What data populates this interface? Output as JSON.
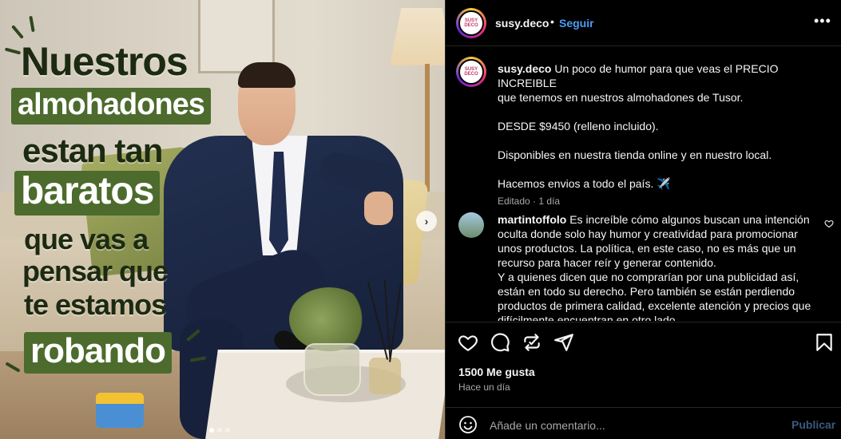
{
  "post": {
    "headline": {
      "line1": "Nuestros",
      "line2": "almohadones",
      "line3": "estan tan",
      "line4": "baratos",
      "line5": "que vas a",
      "line6": "pensar que",
      "line7": "te estamos",
      "line8": "robando"
    },
    "carousel": {
      "next_glyph": "›",
      "current_index": 1,
      "slide_count": 3
    },
    "colors": {
      "headline_box": "#4c6b2d",
      "follow": "#4a9cf5",
      "panel_bg": "#000000"
    }
  },
  "header": {
    "avatar_text": "SUSY DECO",
    "username": "susy.deco",
    "separator": "•",
    "follow_label": "Seguir",
    "more_icon": "more-horizontal-icon",
    "more_glyph": "•••"
  },
  "caption": {
    "username": "susy.deco",
    "line1": "Un poco de humor para que veas el PRECIO INCREIBLE",
    "line2": "que tenemos en nuestros almohadones de Tusor.",
    "line3": "DESDE $9450 (relleno incluido).",
    "line4": "Disponibles en nuestra tienda online y en nuestro local.",
    "line5": "Hacemos envios a todo el país. ✈️",
    "edited": "Editado",
    "dot": "·",
    "time": "1 día"
  },
  "comment": {
    "username": "martintoffolo",
    "text_lines": [
      "Es increíble cómo algunos buscan una intención",
      "oculta donde solo hay humor y creatividad para promocionar",
      "unos productos. La política, en este caso, no es más que un",
      "recurso para hacer reír y generar contenido.",
      "Y a quienes dicen que no comprarían por una publicidad así,",
      "están en todo su derecho. Pero también se están perdiendo",
      "productos de primera calidad, excelente atención y precios que",
      "difícilmente encuentran en otro lado."
    ]
  },
  "actions": {
    "icons": [
      "heart-icon",
      "comment-icon",
      "repost-icon",
      "share-icon",
      "bookmark-icon"
    ],
    "likes": "1500 Me gusta",
    "posted_ago": "Hace un día"
  },
  "add_comment": {
    "placeholder": "Añade un comentario...",
    "publish_label": "Publicar"
  }
}
